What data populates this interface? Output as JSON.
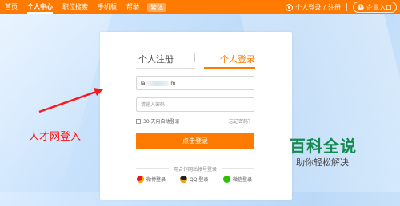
{
  "nav": {
    "items": [
      "首页",
      "个人中心",
      "职位搜索",
      "手机版",
      "帮助"
    ],
    "active_index": 1,
    "badge": "繁体",
    "right": {
      "login_label": "个人登录",
      "separator": "/",
      "register_label": "注册",
      "enterprise_label": "企业入口",
      "enterprise_icon": "HR"
    }
  },
  "login": {
    "tab_register": "个人注册",
    "tab_login": "个人登录",
    "username_prefix": "la",
    "username_suffix": "m",
    "password_placeholder": "请输入密码",
    "remember_label": "30 天内自动登录",
    "forgot_label": "忘记密码？",
    "submit_label": "点击登录",
    "partner_label": "用合作网站帐号登录",
    "social": [
      {
        "icon": "weibo-icon",
        "label": "微博登录"
      },
      {
        "icon": "qq-icon",
        "label": "QQ 登录"
      },
      {
        "icon": "wechat-icon",
        "label": "微信登录"
      }
    ]
  },
  "annotation": {
    "text": "人才网登入",
    "color": "#ff1515"
  },
  "watermark": {
    "title": "百科全说",
    "subtitle": "助你轻松解决"
  },
  "colors": {
    "brand": "#ff7a00",
    "watermark": "#15894f"
  }
}
